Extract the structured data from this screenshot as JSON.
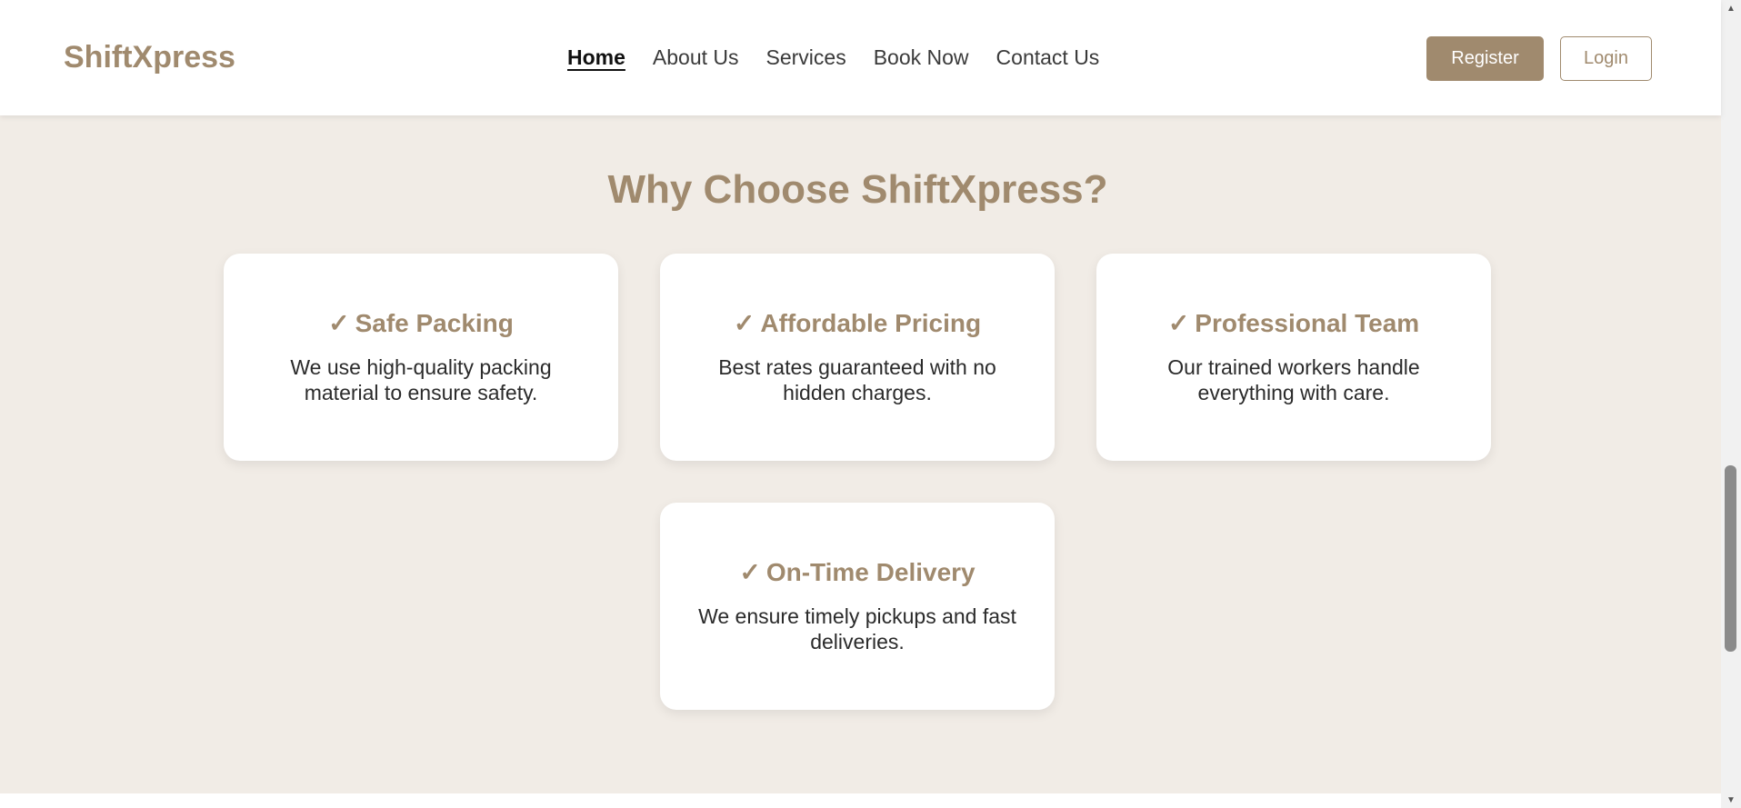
{
  "brand": {
    "name": "ShiftXpress",
    "accent_color": "#a08a6e"
  },
  "nav": {
    "links": [
      {
        "label": "Home",
        "active": true
      },
      {
        "label": "About Us"
      },
      {
        "label": "Services"
      },
      {
        "label": "Book Now"
      },
      {
        "label": "Contact Us"
      }
    ],
    "register_label": "Register",
    "login_label": "Login"
  },
  "section": {
    "title": "Why Choose ShiftXpress?",
    "check_glyph": "✓",
    "cards": [
      {
        "title": "Safe Packing",
        "description": "We use high-quality packing material to ensure safety."
      },
      {
        "title": "Affordable Pricing",
        "description": "Best rates guaranteed with no hidden charges."
      },
      {
        "title": "Professional Team",
        "description": "Our trained workers handle everything with care."
      },
      {
        "title": "On-Time Delivery",
        "description": "We ensure timely pickups and fast deliveries."
      }
    ]
  },
  "scrollbar": {
    "up_icon": "triangle-up-icon",
    "down_icon": "triangle-down-icon"
  }
}
